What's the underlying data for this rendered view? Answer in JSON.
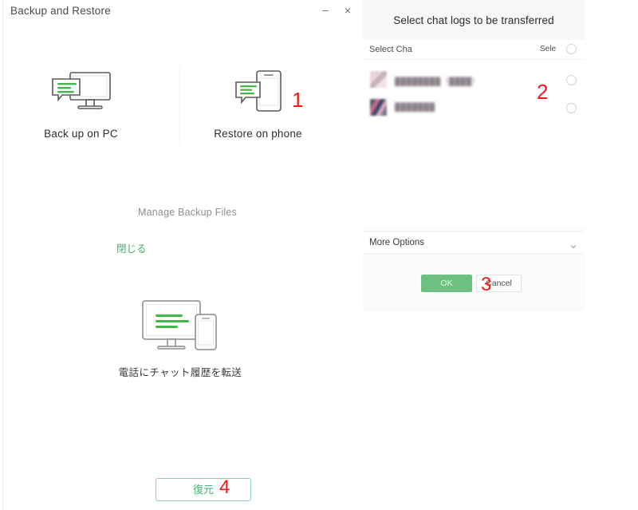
{
  "window": {
    "title": "Backup and Restore",
    "minimize_label": "–",
    "close_label": "×"
  },
  "modes": [
    {
      "label": "Back up on PC",
      "icon": "pc-chat-icon"
    },
    {
      "label": "Restore on phone",
      "icon": "phone-chat-icon"
    }
  ],
  "links": {
    "manage_backup_files": "Manage Backup Files",
    "close": "閉じる"
  },
  "hero": {
    "icon": "pc-to-phone-transfer-icon",
    "caption": "電話にチャット履歴を転送"
  },
  "restore_button": {
    "label": "復元"
  },
  "dialog": {
    "title": "Select chat logs to be transferred",
    "list_header": {
      "label": "Select Cha",
      "select_all_label": "Sele"
    },
    "rows": [
      {
        "name": "████████（████）",
        "selected": false
      },
      {
        "name": "███████",
        "selected": false
      }
    ],
    "more_options": {
      "label": "More Options",
      "icon": "chevron-down-icon"
    },
    "buttons": {
      "ok": "OK",
      "cancel": "Cancel"
    }
  },
  "annotations": [
    {
      "id": "1",
      "label": "1"
    },
    {
      "id": "2",
      "label": "2"
    },
    {
      "id": "3",
      "label": "3"
    },
    {
      "id": "4",
      "label": "4"
    }
  ],
  "colors": {
    "accent_green": "#3cb371",
    "ok_button": "#6ec07e",
    "annotation_red": "#ee1b1b",
    "panel_bg": "#fafafa"
  }
}
